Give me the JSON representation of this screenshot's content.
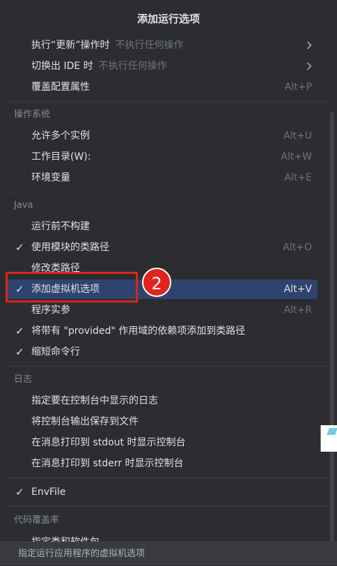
{
  "popup": {
    "title": "添加运行选项",
    "items_top": [
      {
        "label": "执行“更新”操作时",
        "hint": "不执行任何操作",
        "submenu": true
      },
      {
        "label": "切换出 IDE 时",
        "hint": "不执行任何操作",
        "submenu": true
      },
      {
        "label": "覆盖配置属性",
        "shortcut": "Alt+P"
      }
    ],
    "group_os": {
      "header": "操作系统",
      "items": [
        {
          "label": "允许多个实例",
          "shortcut": "Alt+U"
        },
        {
          "label": "工作目录(W):",
          "shortcut": "Alt+W"
        },
        {
          "label": "环境变量",
          "shortcut": "Alt+E"
        }
      ]
    },
    "group_java": {
      "header": "Java",
      "items": [
        {
          "label": "运行前不构建",
          "checked": false
        },
        {
          "label": "使用模块的类路径",
          "shortcut": "Alt+O",
          "checked": true
        },
        {
          "label": "修改类路径",
          "checked": false
        },
        {
          "label": "添加虚拟机选项",
          "shortcut": "Alt+V",
          "checked": true,
          "selected": true
        },
        {
          "label": "程序实参",
          "shortcut": "Alt+R",
          "checked": false
        },
        {
          "label": "将带有 \"provided\" 作用域的依赖项添加到类路径",
          "checked": true
        },
        {
          "label": "缩短命令行",
          "checked": true
        }
      ]
    },
    "group_log": {
      "header": "日志",
      "items": [
        {
          "label": "指定要在控制台中显示的日志"
        },
        {
          "label": "将控制台输出保存到文件"
        },
        {
          "label": "在消息打印到 stdout 时显示控制台"
        },
        {
          "label": "在消息打印到 stderr 时显示控制台"
        }
      ]
    },
    "envfile": {
      "label": "EnvFile",
      "checked": true
    },
    "group_coverage": {
      "header": "代码覆盖率",
      "partial_item": "指定类和软件包"
    },
    "check_glyph": "✓",
    "footer": "指定运行应用程序的虚拟机选项"
  },
  "annotation": {
    "badge": "2",
    "color": "#e0231c"
  }
}
